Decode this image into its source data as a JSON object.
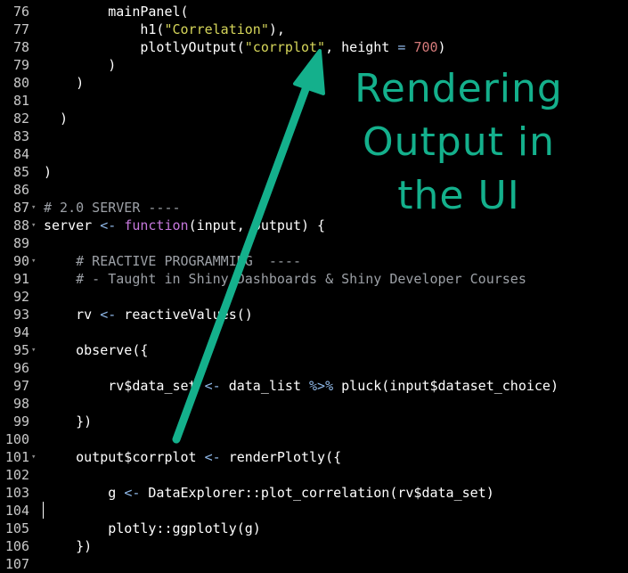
{
  "annotation": {
    "text": "Rendering Output in the UI",
    "lines": [
      "Rendering",
      "Output in",
      "the UI"
    ],
    "color": "#14b08c"
  },
  "editor": {
    "background": "#000000",
    "cursor_line": 104,
    "lines": [
      {
        "num": "76",
        "fold": false,
        "tokens": [
          {
            "t": "        mainPanel(",
            "c": ""
          }
        ]
      },
      {
        "num": "77",
        "fold": false,
        "tokens": [
          {
            "t": "            h1(",
            "c": ""
          },
          {
            "t": "\"Correlation\"",
            "c": "str"
          },
          {
            "t": "),",
            "c": ""
          }
        ]
      },
      {
        "num": "78",
        "fold": false,
        "tokens": [
          {
            "t": "            plotlyOutput(",
            "c": ""
          },
          {
            "t": "\"corrplot\"",
            "c": "str"
          },
          {
            "t": ", height ",
            "c": ""
          },
          {
            "t": "=",
            "c": "op"
          },
          {
            "t": " ",
            "c": ""
          },
          {
            "t": "700",
            "c": "num"
          },
          {
            "t": ")",
            "c": ""
          }
        ]
      },
      {
        "num": "79",
        "fold": false,
        "tokens": [
          {
            "t": "        )",
            "c": ""
          }
        ]
      },
      {
        "num": "80",
        "fold": false,
        "tokens": [
          {
            "t": "    )",
            "c": ""
          }
        ]
      },
      {
        "num": "81",
        "fold": false,
        "tokens": []
      },
      {
        "num": "82",
        "fold": false,
        "tokens": [
          {
            "t": "  )",
            "c": ""
          }
        ]
      },
      {
        "num": "83",
        "fold": false,
        "tokens": []
      },
      {
        "num": "84",
        "fold": false,
        "tokens": []
      },
      {
        "num": "85",
        "fold": false,
        "tokens": [
          {
            "t": ")",
            "c": ""
          }
        ]
      },
      {
        "num": "86",
        "fold": false,
        "tokens": []
      },
      {
        "num": "87",
        "fold": true,
        "tokens": [
          {
            "t": "# 2.0 SERVER ----",
            "c": "cm"
          }
        ]
      },
      {
        "num": "88",
        "fold": true,
        "tokens": [
          {
            "t": "server ",
            "c": ""
          },
          {
            "t": "<-",
            "c": "op"
          },
          {
            "t": " ",
            "c": ""
          },
          {
            "t": "function",
            "c": "kw"
          },
          {
            "t": "(input, output) {",
            "c": ""
          }
        ]
      },
      {
        "num": "89",
        "fold": false,
        "tokens": []
      },
      {
        "num": "90",
        "fold": true,
        "tokens": [
          {
            "t": "    # REACTIVE PROGRAMMING  ----",
            "c": "cm"
          }
        ]
      },
      {
        "num": "91",
        "fold": false,
        "tokens": [
          {
            "t": "    # - Taught in Shiny Dashboards & Shiny Developer Courses",
            "c": "cm"
          }
        ]
      },
      {
        "num": "92",
        "fold": false,
        "tokens": []
      },
      {
        "num": "93",
        "fold": false,
        "tokens": [
          {
            "t": "    rv ",
            "c": ""
          },
          {
            "t": "<-",
            "c": "op"
          },
          {
            "t": " reactiveValues()",
            "c": ""
          }
        ]
      },
      {
        "num": "94",
        "fold": false,
        "tokens": []
      },
      {
        "num": "95",
        "fold": true,
        "tokens": [
          {
            "t": "    observe({",
            "c": ""
          }
        ]
      },
      {
        "num": "96",
        "fold": false,
        "tokens": []
      },
      {
        "num": "97",
        "fold": false,
        "tokens": [
          {
            "t": "        rv$data_set ",
            "c": ""
          },
          {
            "t": "<-",
            "c": "op"
          },
          {
            "t": " data_list ",
            "c": ""
          },
          {
            "t": "%>%",
            "c": "op"
          },
          {
            "t": " pluck(input$dataset_choice)",
            "c": ""
          }
        ]
      },
      {
        "num": "98",
        "fold": false,
        "tokens": []
      },
      {
        "num": "99",
        "fold": false,
        "tokens": [
          {
            "t": "    })",
            "c": ""
          }
        ]
      },
      {
        "num": "100",
        "fold": false,
        "tokens": []
      },
      {
        "num": "101",
        "fold": true,
        "tokens": [
          {
            "t": "    output$corrplot ",
            "c": ""
          },
          {
            "t": "<-",
            "c": "op"
          },
          {
            "t": " renderPlotly({",
            "c": ""
          }
        ]
      },
      {
        "num": "102",
        "fold": false,
        "tokens": []
      },
      {
        "num": "103",
        "fold": false,
        "tokens": [
          {
            "t": "        g ",
            "c": ""
          },
          {
            "t": "<-",
            "c": "op"
          },
          {
            "t": " DataExplorer::plot_correlation(rv$data_set)",
            "c": ""
          }
        ]
      },
      {
        "num": "104",
        "fold": false,
        "tokens": []
      },
      {
        "num": "105",
        "fold": false,
        "tokens": [
          {
            "t": "        plotly::ggplotly(g)",
            "c": ""
          }
        ]
      },
      {
        "num": "106",
        "fold": false,
        "tokens": [
          {
            "t": "    })",
            "c": ""
          }
        ]
      },
      {
        "num": "107",
        "fold": false,
        "tokens": []
      }
    ]
  }
}
